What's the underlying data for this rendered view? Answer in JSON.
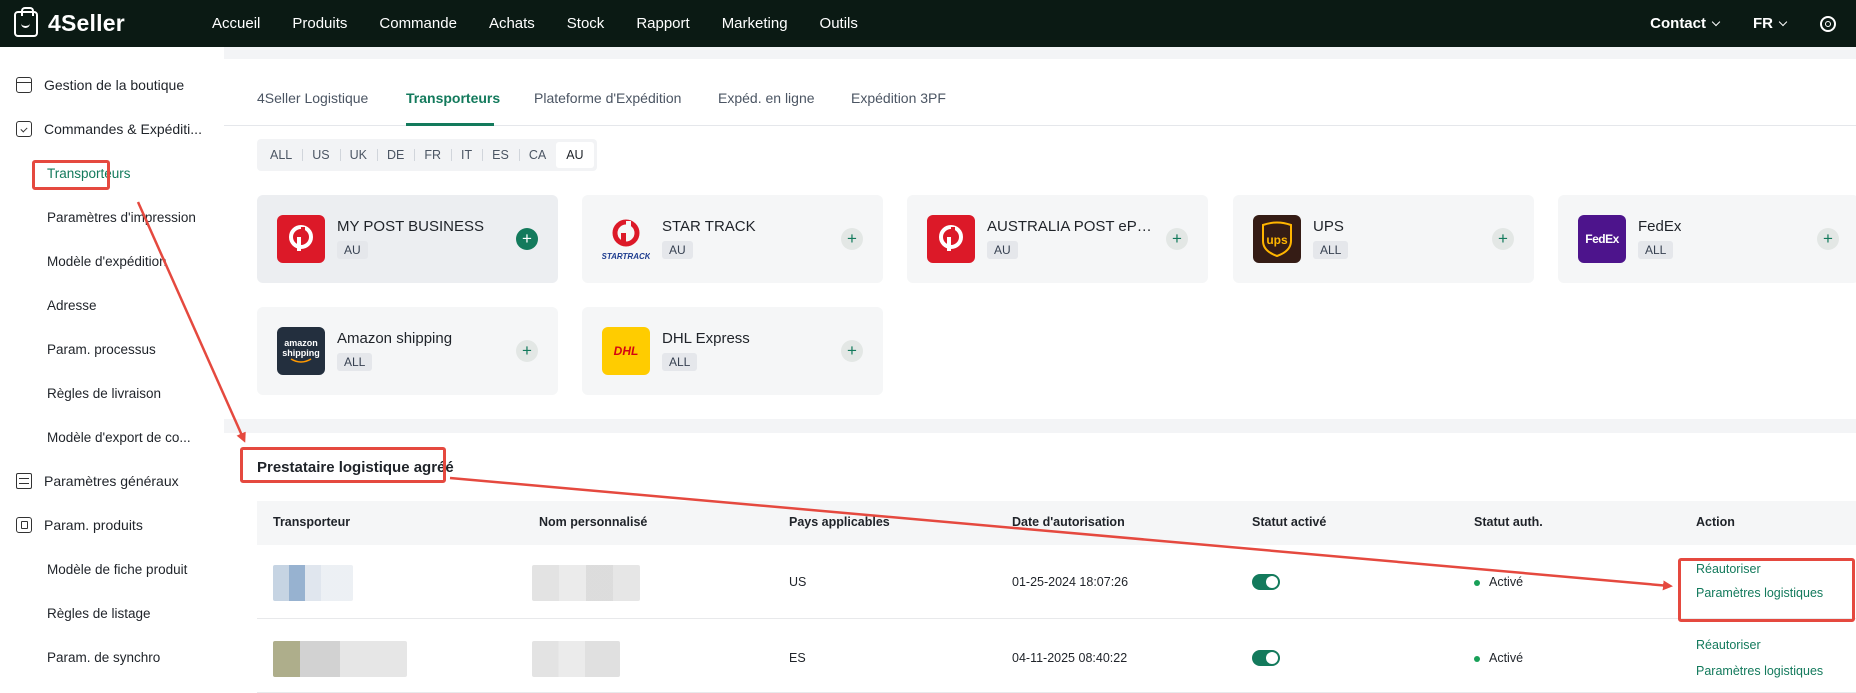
{
  "topbar": {
    "brand": "4Seller",
    "nav": [
      "Accueil",
      "Produits",
      "Commande",
      "Achats",
      "Stock",
      "Rapport",
      "Marketing",
      "Outils"
    ],
    "contact_label": "Contact",
    "language_label": "FR"
  },
  "sidebar": {
    "shop_management": "Gestion de la boutique",
    "orders_shipping": "Commandes & Expéditi...",
    "orders_sub": [
      "Transporteurs",
      "Paramètres d'impression",
      "Modèle d'expédition",
      "Adresse",
      "Param. processus",
      "Règles de livraison",
      "Modèle d'export de co..."
    ],
    "general_settings": "Paramètres généraux",
    "product_settings": "Param. produits",
    "product_sub": [
      "Modèle de fiche produit",
      "Règles de listage",
      "Param. de synchro"
    ]
  },
  "tabs": [
    "4Seller Logistique",
    "Transporteurs",
    "Plateforme d'Expédition",
    "Expéd. en ligne",
    "Expédition 3PF"
  ],
  "active_tab": "Transporteurs",
  "country_filters": [
    "ALL",
    "US",
    "UK",
    "DE",
    "FR",
    "IT",
    "ES",
    "CA",
    "AU"
  ],
  "active_country": "AU",
  "carriers": [
    {
      "name": "MY POST BUSINESS",
      "tag": "AU",
      "logo_text": "",
      "color": "#dc1928"
    },
    {
      "name": "STAR TRACK",
      "tag": "AU",
      "logo_text": "STARTRACK",
      "color": "#dc1928"
    },
    {
      "name": "AUSTRALIA POST ePa...",
      "tag": "AU",
      "logo_text": "",
      "color": "#dc1928"
    },
    {
      "name": "UPS",
      "tag": "ALL",
      "logo_text": "ups",
      "color": "#351c15"
    },
    {
      "name": "FedEx",
      "tag": "ALL",
      "logo_text": "FedEx",
      "color": "#4d148c"
    },
    {
      "name": "Amazon shipping",
      "tag": "ALL",
      "logo_text": "amazon shipping",
      "color": "#232f3e"
    },
    {
      "name": "DHL Express",
      "tag": "ALL",
      "logo_text": "DHL",
      "color": "#ffcc00"
    }
  ],
  "section_title": "Prestataire logistique agréé",
  "table": {
    "headers": [
      "Transporteur",
      "Nom personnalisé",
      "Pays applicables",
      "Date d'autorisation",
      "Statut activé",
      "Statut auth.",
      "Action"
    ],
    "rows": [
      {
        "country": "US",
        "date": "01-25-2024 18:07:26",
        "status": "Activé",
        "reauthorize": "Réautoriser",
        "logistics": "Paramètres logistiques"
      },
      {
        "country": "ES",
        "date": "04-11-2025 08:40:22",
        "status": "Activé",
        "reauthorize": "Réautoriser",
        "logistics": "Paramètres logistiques"
      }
    ]
  },
  "colors": {
    "accent": "#137a5c",
    "annotation": "#e5493f",
    "topbar": "#0b1a14"
  }
}
